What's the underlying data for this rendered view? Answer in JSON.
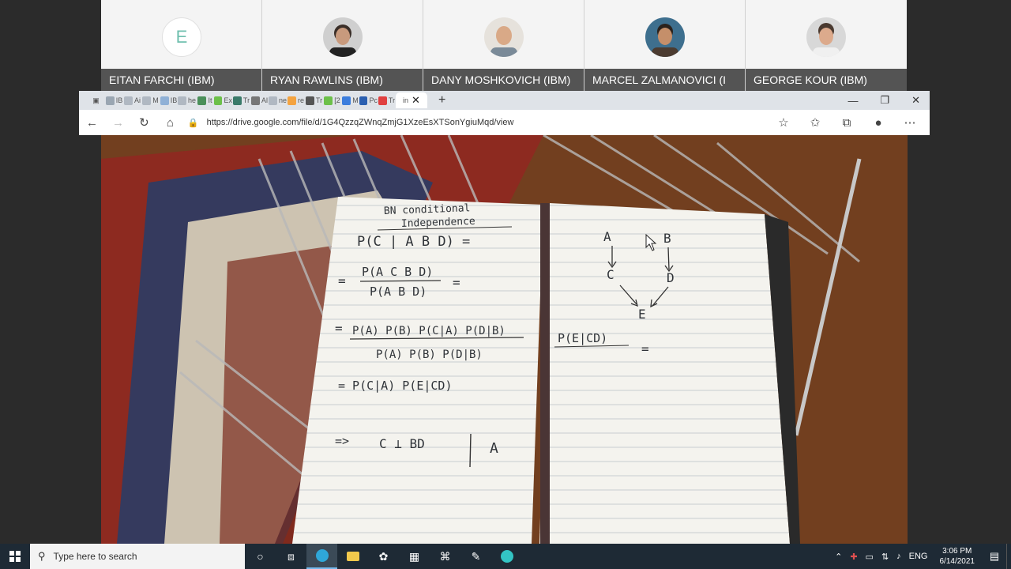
{
  "participants": [
    {
      "name": "EITAN FARCHI (IBM)",
      "initial": "E",
      "avatar": "letter-avatar"
    },
    {
      "name": "RYAN RAWLINS (IBM)",
      "avatar": "photo-avatar"
    },
    {
      "name": "DANY MOSHKOVICH (IBM)",
      "avatar": "photo-avatar"
    },
    {
      "name": "MARCEL ZALMANOVICI (I",
      "avatar": "photo-avatar"
    },
    {
      "name": "GEORGE KOUR (IBM)",
      "avatar": "photo-avatar"
    }
  ],
  "browser": {
    "tabs": [
      "IB",
      "Ai",
      "M",
      "IB",
      "he",
      "It",
      "Ex",
      "Tr",
      "Al",
      "ne",
      "re",
      "Tr",
      "[2",
      "M",
      "Pc",
      "Tr"
    ],
    "active_tab": "in",
    "url": "https://drive.google.com/file/d/1G4QzzqZWnqZmjG1XzeEsXTSonYgiuMqd/view",
    "window_controls": [
      "—",
      "❐",
      "✕"
    ]
  },
  "notebook": {
    "left_page": {
      "title": "BN conditional",
      "title2": "Independence",
      "line1": "P(C | A B D) =",
      "line2_num": "P(A C B D)",
      "line2_den": "P(A B D)",
      "line3_num": "P(A) P(B) P(C|A) P(D|B)",
      "line3_den": "P(A) P(B) P(D|B)",
      "line4": "= P(C|A) P(E|CD)",
      "line5_arrow": "=>",
      "line5": "C ⊥ BD",
      "line5_given": "A"
    },
    "right_page": {
      "node_a": "A",
      "node_b": "B",
      "node_c": "C",
      "node_d": "D",
      "node_e": "E",
      "formula": "P(E|CD)",
      "equals": "="
    }
  },
  "taskbar": {
    "search_placeholder": "Type here to search",
    "time": "3:06 PM",
    "date": "6/14/2021",
    "language": "ENG"
  }
}
